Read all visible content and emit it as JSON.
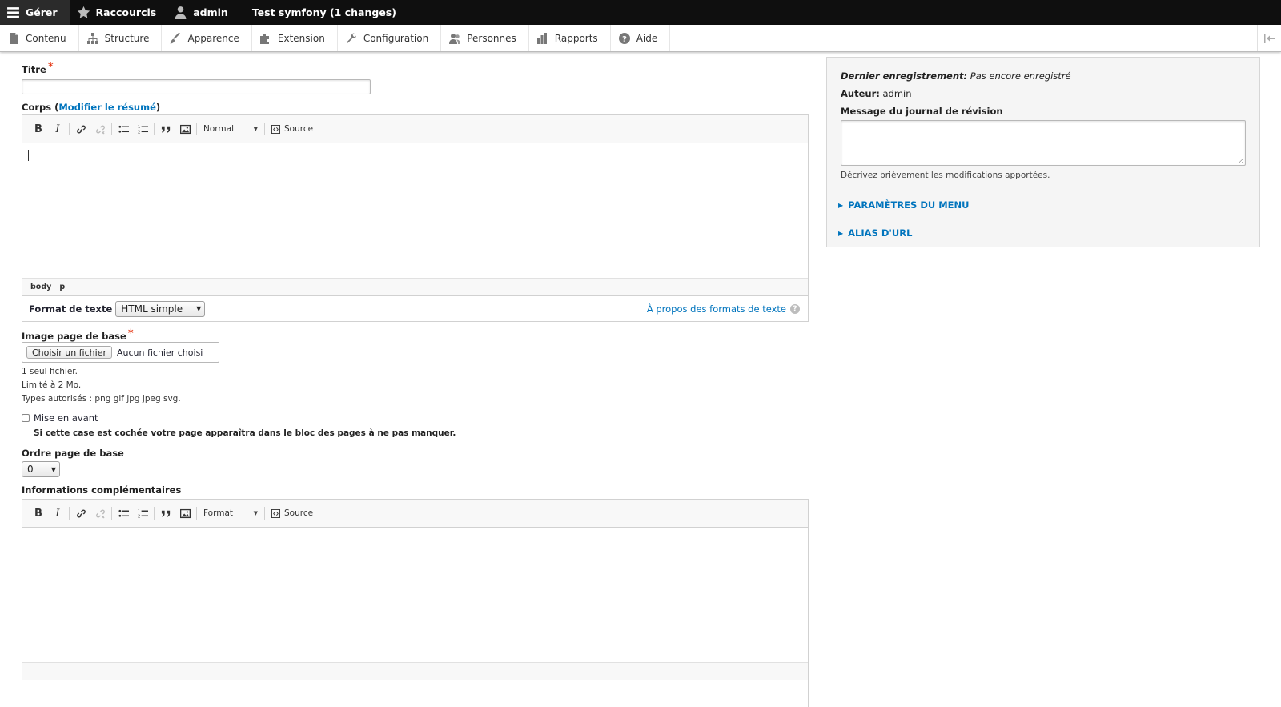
{
  "toolbar": {
    "manage_label": "Gérer",
    "shortcuts_label": "Raccourcis",
    "user_label": "admin",
    "site_label": "Test symfony (1 changes)"
  },
  "tray": {
    "items": [
      {
        "label": "Contenu",
        "icon": "file-icon"
      },
      {
        "label": "Structure",
        "icon": "sitemap-icon"
      },
      {
        "label": "Apparence",
        "icon": "brush-icon"
      },
      {
        "label": "Extension",
        "icon": "puzzle-icon"
      },
      {
        "label": "Configuration",
        "icon": "wrench-icon"
      },
      {
        "label": "Personnes",
        "icon": "people-icon"
      },
      {
        "label": "Rapports",
        "icon": "bar-chart-icon"
      },
      {
        "label": "Aide",
        "icon": "help-icon"
      }
    ]
  },
  "form": {
    "title_label": "Titre",
    "title_value": "",
    "body_label": "Corps",
    "body_summary_link": "Modifier le résumé",
    "body_editor": {
      "format_combo": "Normal",
      "source_label": "Source",
      "path": [
        "body",
        "p"
      ]
    },
    "text_format_label": "Format de texte",
    "text_format_value": "HTML simple",
    "text_format_help": "À propos des formats de texte",
    "image_label": "Image page de base",
    "file_button": "Choisir un fichier",
    "file_status": "Aucun fichier choisi",
    "image_help": [
      "1 seul fichier.",
      "Limité à 2 Mo.",
      "Types autorisés : png gif jpg jpeg svg."
    ],
    "featured_label": "Mise en avant",
    "featured_help": "Si cette case est cochée votre page apparaîtra dans le bloc des pages à ne pas manquer.",
    "order_label": "Ordre page de base",
    "order_value": "0",
    "info_label": "Informations complémentaires",
    "info_editor": {
      "format_combo": "Format",
      "source_label": "Source"
    }
  },
  "sidebar": {
    "last_saved_label": "Dernier enregistrement:",
    "last_saved_value": "Pas encore enregistré",
    "author_label": "Auteur:",
    "author_value": "admin",
    "revision_label": "Message du journal de révision",
    "revision_value": "",
    "revision_help": "Décrivez brièvement les modifications apportées.",
    "menu_settings": "PARAMÈTRES DU MENU",
    "url_alias": "ALIAS D'URL"
  },
  "colors": {
    "link": "#0074bd",
    "required": "#e32700",
    "toolbar_bg": "#0f0f0f"
  }
}
